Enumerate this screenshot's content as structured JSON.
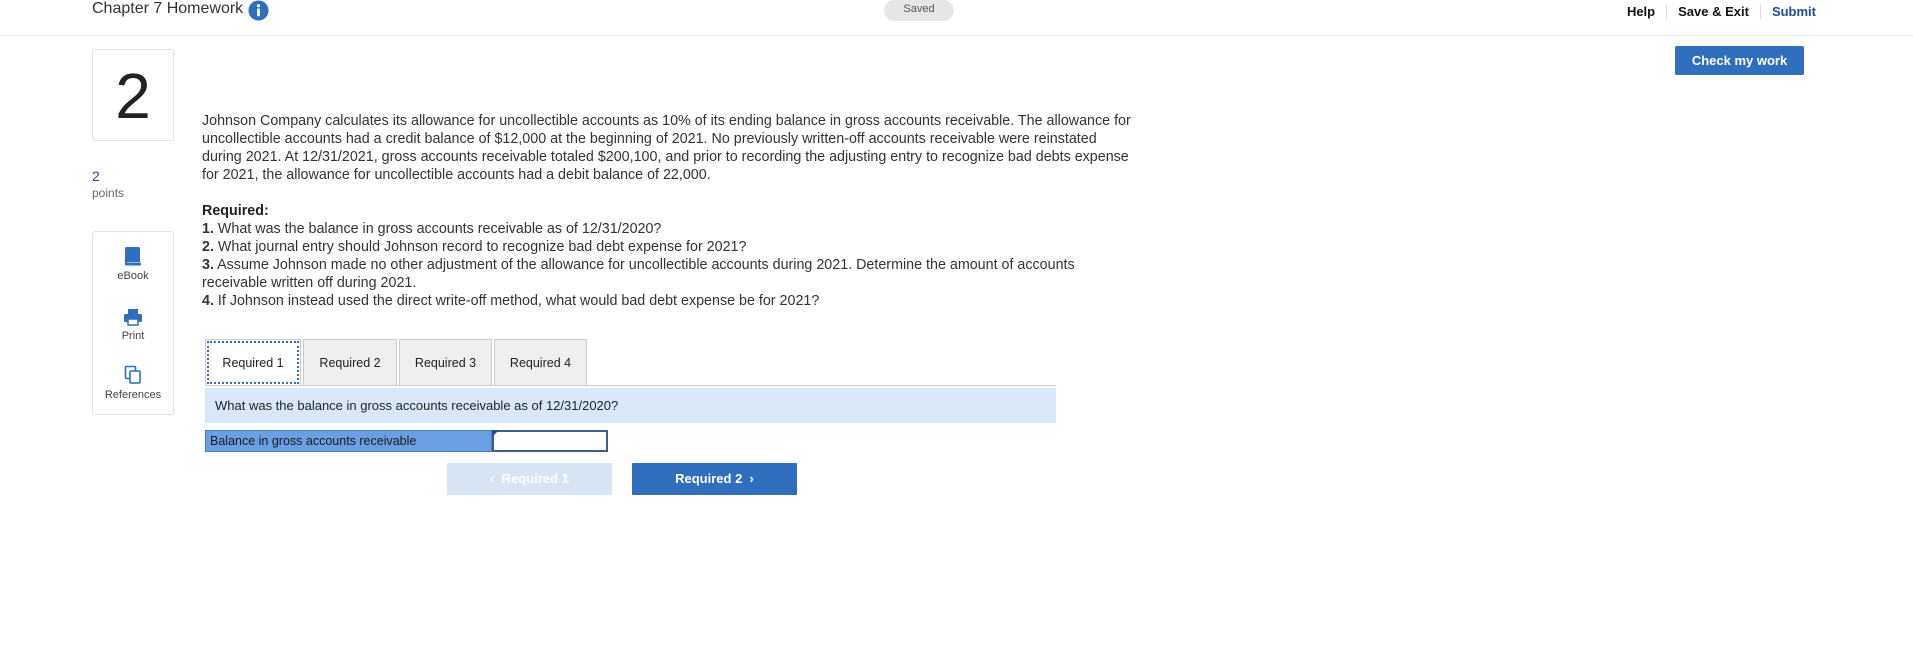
{
  "header": {
    "title": "Chapter 7 Homework",
    "saved": "Saved",
    "help": "Help",
    "save_exit": "Save & Exit",
    "submit": "Submit"
  },
  "question": {
    "number": "2",
    "points_value": "2",
    "points_label": "points",
    "text": "Johnson Company calculates its allowance for uncollectible accounts as 10% of its ending balance in gross accounts receivable. The allowance for uncollectible accounts had a credit balance of $12,000 at the beginning of 2021.  No previously written-off accounts receivable were reinstated during 2021.  At 12/31/2021, gross accounts receivable totaled $200,100, and prior to recording the adjusting entry to recognize bad debts expense for 2021, the allowance for uncollectible accounts had a debit balance of 22,000."
  },
  "required": {
    "heading": "Required:",
    "items": [
      {
        "num": "1.",
        "text": " What was the balance in gross accounts receivable as of 12/31/2020?"
      },
      {
        "num": "2.",
        "text": " What journal entry should Johnson record to recognize bad debt expense for 2021?"
      },
      {
        "num": "3.",
        "text": " Assume Johnson made no other adjustment of the allowance for uncollectible accounts during 2021. Determine the amount of accounts receivable written off during 2021."
      },
      {
        "num": "4.",
        "text": " If Johnson instead used the direct write-off method, what would bad debt expense be for 2021?"
      }
    ]
  },
  "tools": {
    "ebook": "eBook",
    "print": "Print",
    "references": "References"
  },
  "check_my_work": "Check my work",
  "tabs": [
    {
      "label": "Required 1",
      "active": true
    },
    {
      "label": "Required 2",
      "active": false
    },
    {
      "label": "Required 3",
      "active": false
    },
    {
      "label": "Required 4",
      "active": false
    }
  ],
  "prompt": "What was the balance in gross accounts receivable as of 12/31/2020?",
  "answer": {
    "label": "Balance in gross accounts receivable",
    "value": ""
  },
  "nav": {
    "prev_label": "Required 1",
    "next_label": "Required 2"
  },
  "colors": {
    "accent": "#2f6fbd",
    "prompt_bg": "#d9e8f8",
    "label_bg": "#6a9fe3"
  },
  "icons": {
    "info": "info-icon",
    "ebook": "book-icon",
    "print": "printer-icon",
    "references": "copy-icon",
    "prev": "chevron-left-icon",
    "next": "chevron-right-icon"
  }
}
